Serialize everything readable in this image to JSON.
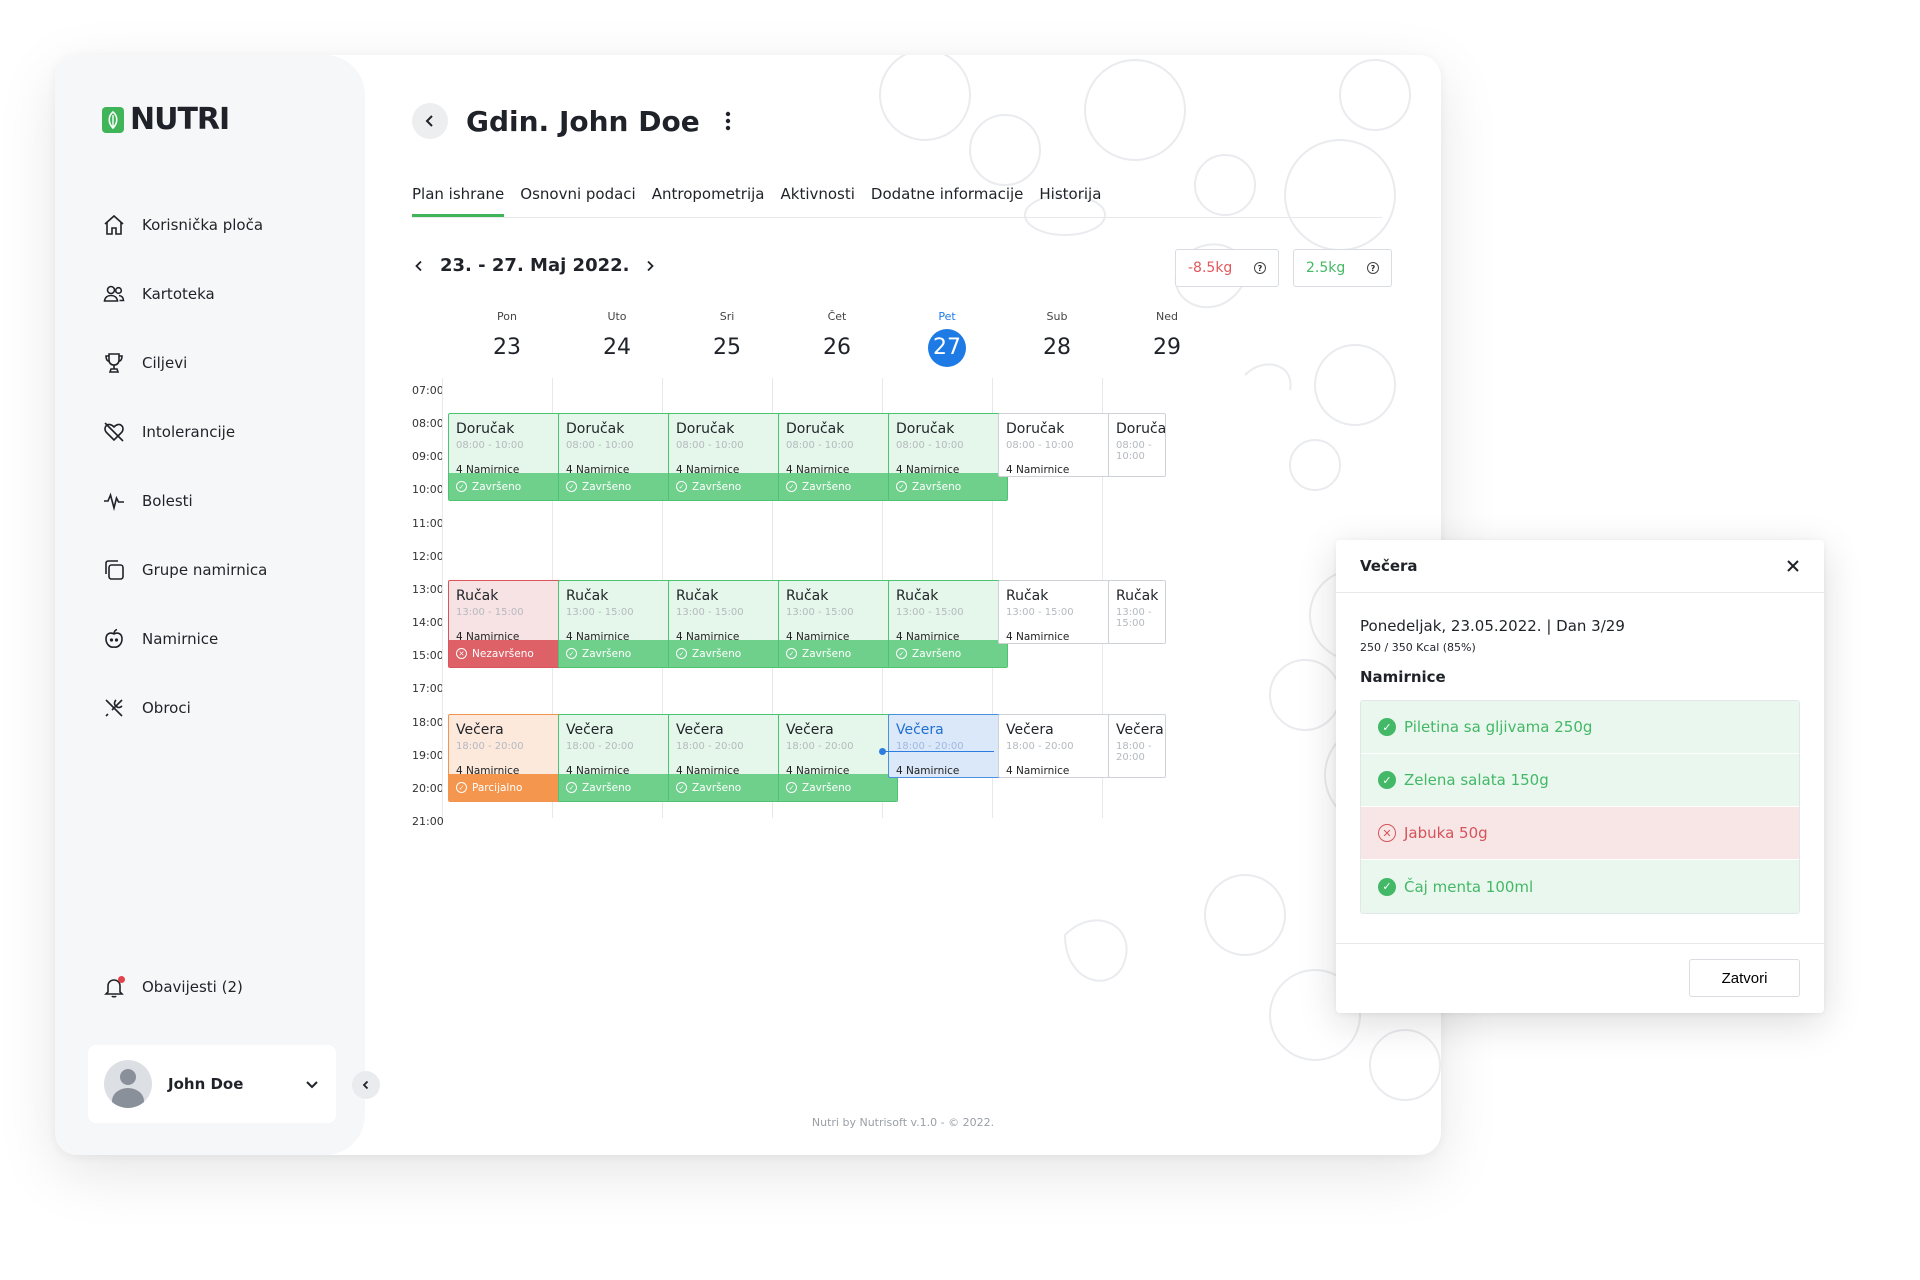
{
  "brand": {
    "name": "NUTRI",
    "accent": "#3fb458"
  },
  "nav": {
    "items": [
      {
        "label": "Korisnička ploča",
        "icon": "home-icon"
      },
      {
        "label": "Kartoteka",
        "icon": "users-icon"
      },
      {
        "label": "Ciljevi",
        "icon": "trophy-icon"
      },
      {
        "label": "Intolerancije",
        "icon": "heart-off-icon"
      },
      {
        "label": "Bolesti",
        "icon": "pulse-icon"
      },
      {
        "label": "Grupe namirnica",
        "icon": "copy-icon"
      },
      {
        "label": "Namirnice",
        "icon": "apple-icon"
      },
      {
        "label": "Obroci",
        "icon": "cutlery-icon"
      }
    ],
    "notifications": "Obavijesti (2)",
    "user": "John Doe"
  },
  "header": {
    "title": "Gdin. John Doe"
  },
  "tabs": [
    "Plan ishrane",
    "Osnovni podaci",
    "Antropometrija",
    "Aktivnosti",
    "Dodatne informacije",
    "Historija"
  ],
  "week": {
    "label": "23. - 27. Maj 2022."
  },
  "stats": [
    {
      "value": "-8.5kg",
      "color": "#e0585e"
    },
    {
      "value": "2.5kg",
      "color": "#43b866"
    }
  ],
  "days": [
    {
      "name": "Pon",
      "num": "23"
    },
    {
      "name": "Uto",
      "num": "24"
    },
    {
      "name": "Sri",
      "num": "25"
    },
    {
      "name": "Čet",
      "num": "26"
    },
    {
      "name": "Pet",
      "num": "27",
      "today": true
    },
    {
      "name": "Sub",
      "num": "28"
    },
    {
      "name": "Ned",
      "num": "29"
    }
  ],
  "times": [
    "07:00",
    "08:00",
    "09:00",
    "10:00",
    "11:00",
    "12:00",
    "13:00",
    "14:00",
    "15:00",
    "17:00",
    "18:00",
    "19:00",
    "20:00",
    "21:00"
  ],
  "meal_types": [
    {
      "title": "Doručak",
      "time": "08:00 - 10:00",
      "items": "4 Namirnice"
    },
    {
      "title": "Ručak",
      "time": "13:00 - 15:00",
      "items": "4 Namirnice"
    },
    {
      "title": "Večera",
      "time": "18:00 - 20:00",
      "items": "4 Namirnice"
    }
  ],
  "statuses": {
    "done": "Završeno",
    "missed": "Nezavršeno",
    "partial": "Parcijalno"
  },
  "meals": [
    [
      "done",
      "done",
      "done",
      "done",
      "done",
      "none",
      "none"
    ],
    [
      "missed",
      "done",
      "done",
      "done",
      "done",
      "none",
      "none"
    ],
    [
      "partial",
      "done",
      "done",
      "done",
      "current",
      "none",
      "none"
    ]
  ],
  "footer": "Nutri by Nutrisoft v.1.0 - © 2022.",
  "modal": {
    "title": "Večera",
    "date": "Ponedeljak, 23.05.2022. | Dan 3/29",
    "kcal": "250 / 350 Kcal (85%)",
    "section": "Namirnice",
    "ingredients": [
      {
        "name": "Piletina sa gljivama 250g",
        "ok": true
      },
      {
        "name": "Zelena salata 150g",
        "ok": true
      },
      {
        "name": "Jabuka 50g",
        "ok": false
      },
      {
        "name": "Čaj menta 100ml",
        "ok": true
      }
    ],
    "close_label": "Zatvori"
  }
}
